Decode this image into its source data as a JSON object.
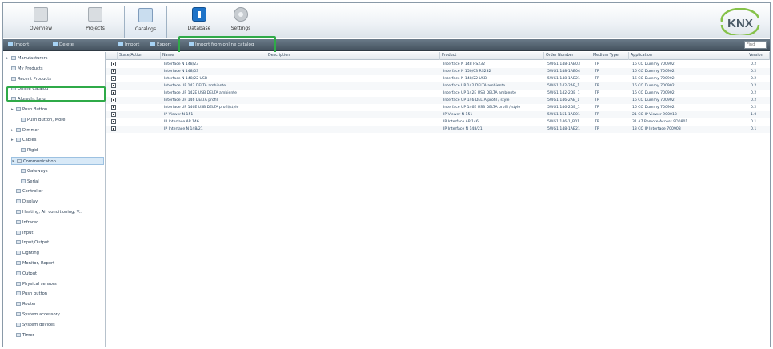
{
  "ribbon": {
    "tabs": [
      {
        "label": "Overview",
        "icon": "overview-icon"
      },
      {
        "label": "Projects",
        "icon": "projects-icon"
      },
      {
        "label": "Catalogs",
        "icon": "catalogs-icon",
        "active": true
      },
      {
        "label": "Database",
        "icon": "database-icon"
      },
      {
        "label": "Settings",
        "icon": "settings-icon"
      }
    ],
    "logo": "KNX"
  },
  "toolbar": {
    "left_buttons": [
      "Import",
      "Delete"
    ],
    "buttons": [
      "Import",
      "Export"
    ],
    "highlighted_button": "Import from online catalog",
    "search_placeholder": "Find"
  },
  "tree": {
    "items": [
      {
        "label": "Manufacturers",
        "expander": "▸",
        "level": 0
      },
      {
        "label": "My Products",
        "expander": "",
        "level": 0
      },
      {
        "label": "Recent Products",
        "expander": "",
        "level": 0
      },
      {
        "label": "Online Catalog",
        "expander": "▸",
        "level": 0,
        "highlighted": true
      },
      {
        "label": "Albrecht Jung",
        "expander": "▾",
        "level": 0
      },
      {
        "label": "Push Button",
        "expander": "▸",
        "level": 1
      },
      {
        "label": "Push Button, More",
        "expander": "",
        "level": 2
      },
      {
        "label": "Dimmer",
        "expander": "▸",
        "level": 1
      },
      {
        "label": "Cables",
        "expander": "▸",
        "level": 1
      },
      {
        "label": "Rigid",
        "expander": "",
        "level": 2
      },
      {
        "label": "Communication",
        "expander": "▾",
        "level": 1,
        "selected": true
      },
      {
        "label": "Gateways",
        "expander": "",
        "level": 2
      },
      {
        "label": "Serial",
        "expander": "",
        "level": 2
      },
      {
        "label": "Controller",
        "expander": "",
        "level": 1
      },
      {
        "label": "Display",
        "expander": "",
        "level": 1
      },
      {
        "label": "Heating, Air conditioning, V...",
        "expander": "",
        "level": 1
      },
      {
        "label": "Infrared",
        "expander": "",
        "level": 1
      },
      {
        "label": "Input",
        "expander": "",
        "level": 1
      },
      {
        "label": "Input/Output",
        "expander": "",
        "level": 1
      },
      {
        "label": "Lighting",
        "expander": "",
        "level": 1
      },
      {
        "label": "Monitor, Report",
        "expander": "",
        "level": 1
      },
      {
        "label": "Output",
        "expander": "",
        "level": 1
      },
      {
        "label": "Physical sensors",
        "expander": "",
        "level": 1
      },
      {
        "label": "Push button",
        "expander": "",
        "level": 1
      },
      {
        "label": "Router",
        "expander": "",
        "level": 1
      },
      {
        "label": "System accessory",
        "expander": "",
        "level": 1
      },
      {
        "label": "System devices",
        "expander": "",
        "level": 1
      },
      {
        "label": "Timer",
        "expander": "",
        "level": 1
      }
    ]
  },
  "grid": {
    "columns": [
      "",
      "State/Action",
      "Name",
      "Description",
      "Product",
      "Order Number",
      "Medium Type",
      "Application",
      "Version"
    ],
    "rows": [
      {
        "name": "Interface N 148/23",
        "product": "Interface N 148 RS232",
        "order": "5WG1 148-1AB03",
        "medium": "TP",
        "application": "16 CO Dummy 700902",
        "version": "0.2"
      },
      {
        "name": "Interface N 148/03",
        "product": "Interface N 150/03 RS232",
        "order": "5WG1 148-1AB04",
        "medium": "TP",
        "application": "16 CO Dummy 700902",
        "version": "0.2"
      },
      {
        "name": "Interface N 148/22 USB",
        "product": "Interface N 148/22 USB",
        "order": "5WG1 148-1AB21",
        "medium": "TP",
        "application": "16 CO Dummy 700902",
        "version": "0.2"
      },
      {
        "name": "Interface UP 142 DELTA ambiente",
        "product": "Interface UP 142 DELTA ambiente",
        "order": "5WG1 142-2AB_1",
        "medium": "TP",
        "application": "16 CO Dummy 700902",
        "version": "0.2"
      },
      {
        "name": "Interface UP 142E USB DELTA ambiente",
        "product": "Interface UP 142E USB DELTA ambiente",
        "order": "5WG1 142-2DB_1",
        "medium": "TP",
        "application": "16 CO Dummy 700902",
        "version": "0.2"
      },
      {
        "name": "Interface UP 146 DELTA profil",
        "product": "Interface UP 146 DELTA profil / style",
        "order": "5WG1 146-2AB_1",
        "medium": "TP",
        "application": "16 CO Dummy 700902",
        "version": "0.2"
      },
      {
        "name": "Interface UP 146E USB DELTA profil/style",
        "product": "Interface UP 146E USB DELTA profil / style",
        "order": "5WG1 146-2DB_1",
        "medium": "TP",
        "application": "16 CO Dummy 700902",
        "version": "0.2"
      },
      {
        "name": "IP Viewer N 151",
        "product": "IP Viewer N 151",
        "order": "5WG1 151-1AB01",
        "medium": "TP",
        "application": "21 CO IP Viewer 900018",
        "version": "1.0"
      },
      {
        "name": "IP Interface AP 146",
        "product": "IP Interface AP 146",
        "order": "5WG1 146-1_B01",
        "medium": "TP",
        "application": "31 A7 Remote Access 9D0801",
        "version": "0.1"
      },
      {
        "name": "IP Interface N 148/21",
        "product": "IP Interface N 148/21",
        "order": "5WG1 148-1AB21",
        "medium": "TP",
        "application": "13 CO IP Interface 700903",
        "version": "0.1"
      }
    ]
  },
  "colors": {
    "highlight": "#2faa48",
    "toolbar": "#4a5865",
    "selected": "#d8e9f7"
  }
}
